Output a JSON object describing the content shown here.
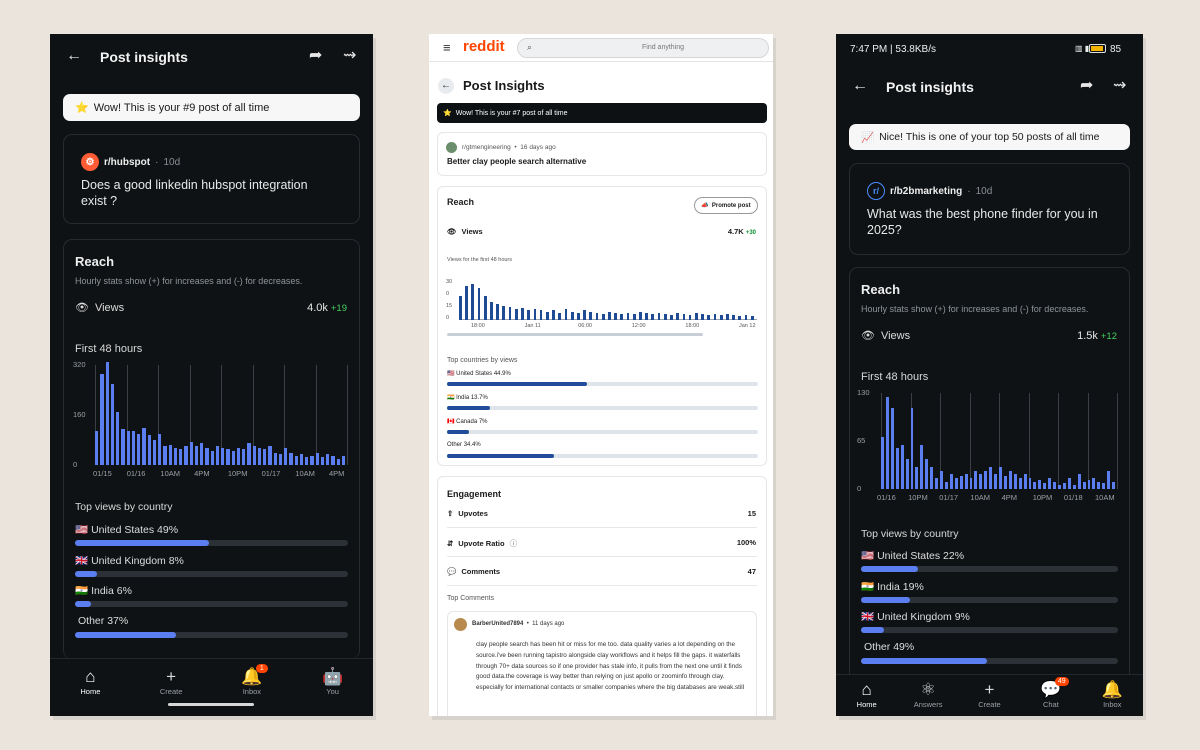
{
  "phone1": {
    "header_title": "Post insights",
    "banner": "Wow! This is your #9 post of all time",
    "subreddit": "r/hubspot",
    "age": "10d",
    "post_title": "Does a good linkedin hubspot integration exist ?",
    "reach_title": "Reach",
    "reach_sub": "Hourly stats show (+) for increases and (-) for decreases.",
    "views_label": "Views",
    "views_value": "4.0k",
    "views_delta": "+19",
    "first48": "First 48 hours",
    "top_views_title": "Top views by country",
    "countries": [
      {
        "flag": "🇺🇸",
        "name": "United States",
        "pct": "49%",
        "value": 49
      },
      {
        "flag": "🇬🇧",
        "name": "United Kingdom",
        "pct": "8%",
        "value": 8
      },
      {
        "flag": "🇮🇳",
        "name": "India",
        "pct": "6%",
        "value": 6
      },
      {
        "flag": "",
        "name": "Other",
        "pct": "37%",
        "value": 37
      }
    ],
    "nav": [
      {
        "label": "Home",
        "icon": "home-icon",
        "active": true
      },
      {
        "label": "Create",
        "icon": "plus-icon"
      },
      {
        "label": "Inbox",
        "icon": "bell-icon",
        "badge": "1"
      },
      {
        "label": "You",
        "icon": "avatar-icon"
      }
    ]
  },
  "phone2": {
    "logo": "reddit",
    "search_placeholder": "Find anything",
    "header_title": "Post Insights",
    "banner": "Wow! This is your #7 post of all time",
    "subreddit": "r/gtmengineering",
    "age": "16 days ago",
    "post_title": "Better clay people search alternative",
    "reach_title": "Reach",
    "promote_label": "Promote post",
    "views_label": "Views",
    "views_value": "4.7K",
    "views_delta": "+30",
    "first48": "Views for the first 48 hours",
    "top_countries_title": "Top countries by views",
    "countries": [
      {
        "flag": "🇺🇸",
        "name": "United States",
        "pct": "44.9%",
        "value": 44.9
      },
      {
        "flag": "🇮🇳",
        "name": "India",
        "pct": "13.7%",
        "value": 13.7
      },
      {
        "flag": "🇨🇦",
        "name": "Canada",
        "pct": "7%",
        "value": 7
      },
      {
        "flag": "",
        "name": "Other",
        "pct": "34.4%",
        "value": 34.4
      }
    ],
    "engagement_title": "Engagement",
    "upvotes_label": "Upvotes",
    "upvotes_value": "15",
    "ratio_label": "Upvote Ratio",
    "ratio_value": "100%",
    "comments_label": "Comments",
    "comments_value": "47",
    "top_comments_title": "Top Comments",
    "commenter": "BarberUnited7894",
    "comment_age": "11 days ago",
    "comment_text": "clay people search has been hit or miss for me too. data quality varies a lot depending on the source.i've been running tapistro alongside clay workflows and it helps fill the gaps. it waterfalls through 70+ data sources so if one provider has stale info, it pulls from the next one until it finds good data.the coverage is way better than relying on just apollo or zoominfo through clay. especially for international contacts or smaller companies where the big databases are weak.still"
  },
  "phone3": {
    "status_time": "7:47 PM | 53.8KB/s",
    "status_right": "85",
    "header_title": "Post insights",
    "banner": "Nice! This is one of your top 50 posts of all time",
    "subreddit": "r/b2bmarketing",
    "age": "10d",
    "post_title": "What was the best phone finder for you in 2025?",
    "reach_title": "Reach",
    "reach_sub": "Hourly stats show (+) for increases and (-) for decreases.",
    "views_label": "Views",
    "views_value": "1.5k",
    "views_delta": "+12",
    "first48": "First 48 hours",
    "top_views_title": "Top views by country",
    "countries": [
      {
        "flag": "🇺🇸",
        "name": "United States",
        "pct": "22%",
        "value": 22
      },
      {
        "flag": "🇮🇳",
        "name": "India",
        "pct": "19%",
        "value": 19
      },
      {
        "flag": "🇬🇧",
        "name": "United Kingdom",
        "pct": "9%",
        "value": 9
      },
      {
        "flag": "",
        "name": "Other",
        "pct": "49%",
        "value": 49
      }
    ],
    "nav": [
      {
        "label": "Home",
        "icon": "home-icon",
        "active": true
      },
      {
        "label": "Answers",
        "icon": "answers-icon"
      },
      {
        "label": "Create",
        "icon": "plus-icon"
      },
      {
        "label": "Chat",
        "icon": "chat-icon",
        "badge": "49"
      },
      {
        "label": "Inbox",
        "icon": "bell-icon"
      }
    ]
  },
  "chart_data": [
    {
      "type": "bar",
      "title": "First 48 hours",
      "yticks": [
        "320",
        "160",
        "0"
      ],
      "ylim": [
        0,
        320
      ],
      "xticks": [
        "01/15",
        "01/16",
        "10AM",
        "4PM",
        "10PM",
        "01/17",
        "10AM",
        "4PM"
      ],
      "values": [
        110,
        290,
        330,
        260,
        170,
        115,
        110,
        108,
        100,
        120,
        95,
        80,
        100,
        60,
        65,
        55,
        50,
        60,
        75,
        60,
        70,
        55,
        45,
        60,
        55,
        50,
        45,
        55,
        50,
        70,
        60,
        55,
        50,
        60,
        40,
        35,
        55,
        40,
        30,
        35,
        25,
        30,
        40,
        25,
        35,
        30,
        20,
        30
      ]
    },
    {
      "type": "bar",
      "title": "Views for the first 48 hours",
      "yticks": [
        "30",
        "0",
        "15",
        "0"
      ],
      "ylim": [
        0,
        30
      ],
      "xticks": [
        "18:00",
        "Jan 11",
        "06:00",
        "12:00",
        "18:00",
        "Jan 12"
      ],
      "values": [
        20,
        28,
        30,
        27,
        20,
        15,
        13,
        12,
        11,
        9,
        10,
        8,
        9,
        8,
        7,
        8,
        6,
        9,
        7,
        6,
        8,
        7,
        6,
        5,
        7,
        6,
        5,
        6,
        5,
        7,
        6,
        5,
        6,
        5,
        4,
        6,
        5,
        4,
        6,
        5,
        4,
        5,
        4,
        5,
        4,
        3,
        4,
        3
      ]
    },
    {
      "type": "bar",
      "title": "First 48 hours",
      "yticks": [
        "130",
        "65",
        "0"
      ],
      "ylim": [
        0,
        130
      ],
      "xticks": [
        "01/16",
        "10PM",
        "01/17",
        "10AM",
        "4PM",
        "10PM",
        "01/18",
        "10AM"
      ],
      "values": [
        70,
        125,
        110,
        55,
        60,
        40,
        110,
        30,
        60,
        40,
        30,
        15,
        25,
        10,
        20,
        15,
        18,
        20,
        15,
        25,
        20,
        25,
        30,
        20,
        30,
        18,
        25,
        20,
        15,
        20,
        15,
        10,
        12,
        8,
        15,
        10,
        5,
        8,
        15,
        5,
        20,
        10,
        12,
        15,
        10,
        8,
        25,
        10
      ]
    }
  ]
}
